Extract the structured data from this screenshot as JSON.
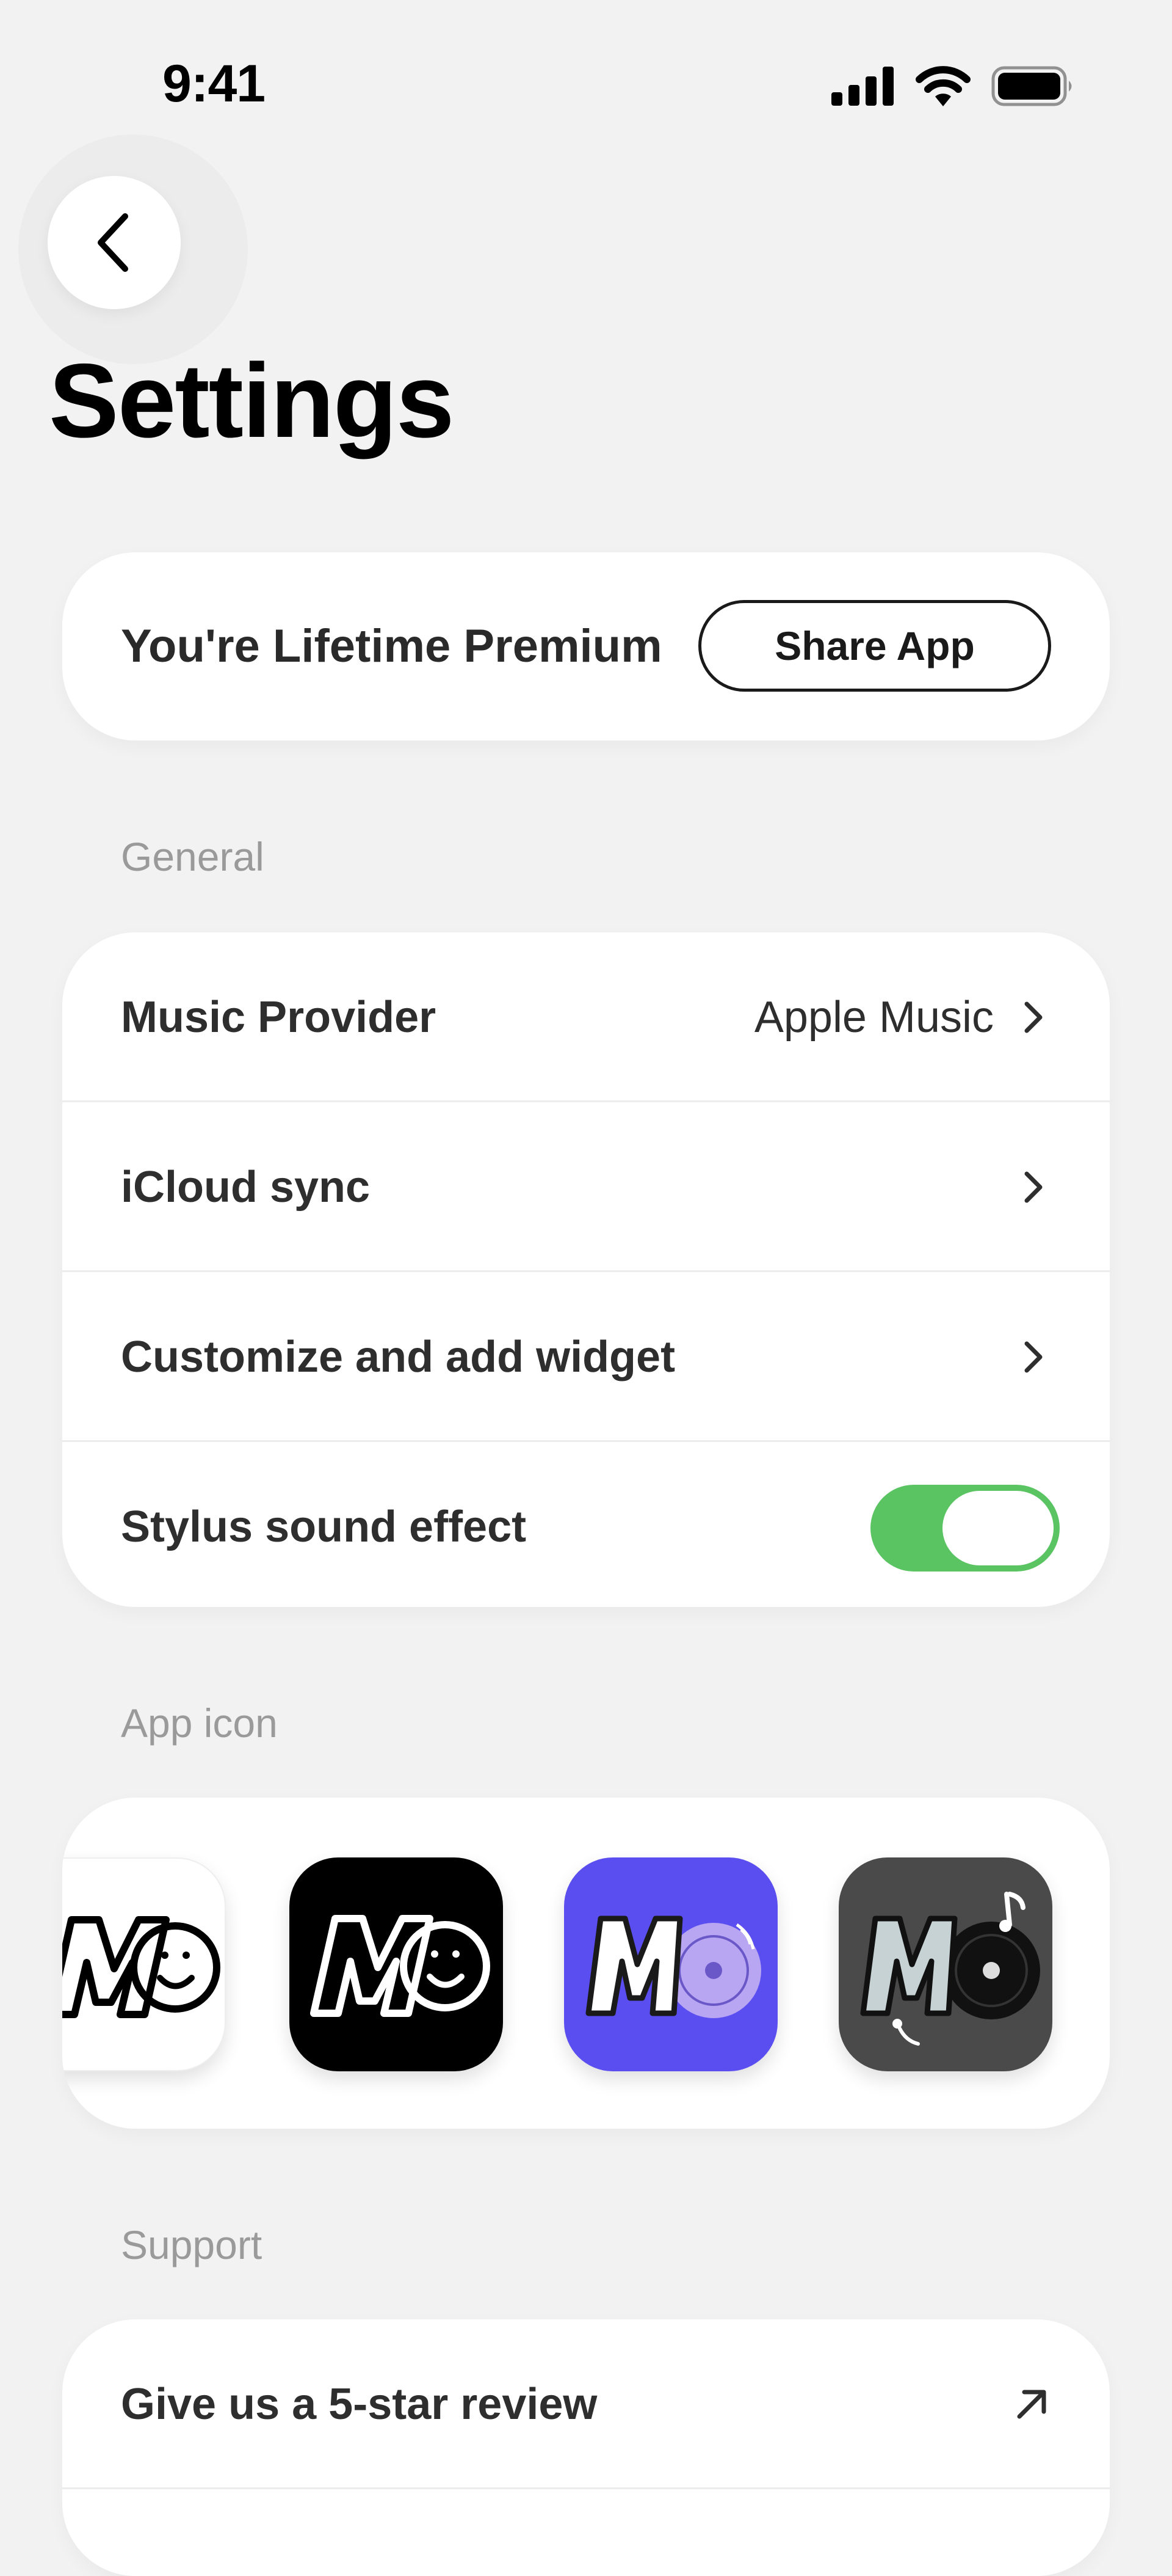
{
  "status_bar": {
    "time": "9:41",
    "icons": [
      "cellular-signal-icon",
      "wifi-icon",
      "battery-icon"
    ]
  },
  "navigation": {
    "back_icon": "chevron-left-icon"
  },
  "page": {
    "title": "Settings"
  },
  "premium": {
    "status_text": "You're Lifetime Premium",
    "share_label": "Share App"
  },
  "general": {
    "section_label": "General",
    "rows": [
      {
        "label": "Music Provider",
        "value": "Apple Music",
        "accessory": "chevron-right-icon"
      },
      {
        "label": "iCloud sync",
        "accessory": "chevron-right-icon"
      },
      {
        "label": "Customize and add widget",
        "accessory": "chevron-right-icon"
      },
      {
        "label": "Stylus sound effect",
        "toggle_on": true
      }
    ]
  },
  "app_icon": {
    "section_label": "App icon",
    "options": [
      {
        "name": "white-md-logo",
        "background": "#ffffff"
      },
      {
        "name": "black-md-logo",
        "background": "#000000"
      },
      {
        "name": "purple-md-vinyl-logo",
        "background": "#5b4ef0"
      },
      {
        "name": "gray-md-record-logo",
        "background": "#4a4a4a"
      }
    ]
  },
  "support": {
    "section_label": "Support",
    "rows": [
      {
        "label": "Give us a 5-star review",
        "accessory": "arrow-up-right-icon"
      }
    ]
  },
  "colors": {
    "background": "#f2f2f2",
    "card": "#ffffff",
    "toggle_on": "#5ac463",
    "section_label": "#9a9a9a",
    "purple_icon": "#5b4ef0"
  }
}
